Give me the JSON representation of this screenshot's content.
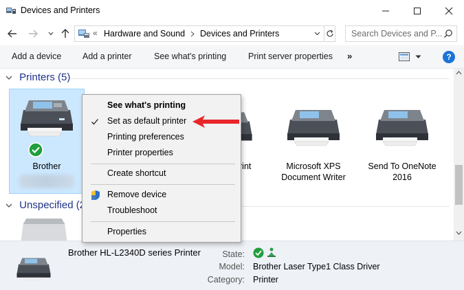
{
  "window": {
    "title": "Devices and Printers"
  },
  "address": {
    "overflow": "«",
    "crumb1": "Hardware and Sound",
    "crumb2": "Devices and Printers",
    "search_placeholder": "Search Devices and P..."
  },
  "toolbar": {
    "add_device": "Add a device",
    "add_printer": "Add a printer",
    "see_printing": "See what's printing",
    "print_server": "Print server properties",
    "more": "»",
    "help": "?"
  },
  "groups": {
    "printers": "Printers (5)",
    "unspecified": "Unspecified (2"
  },
  "devices": [
    {
      "label": "Brother"
    },
    {
      "label": "rint"
    },
    {
      "label": "Microsoft XPS Document Writer"
    },
    {
      "label": "Send To OneNote 2016"
    }
  ],
  "context_menu": {
    "items": [
      {
        "label": "See what's printing"
      },
      {
        "label": "Set as default printer"
      },
      {
        "label": "Printing preferences"
      },
      {
        "label": "Printer properties"
      },
      {
        "label": "Create shortcut"
      },
      {
        "label": "Remove device"
      },
      {
        "label": "Troubleshoot"
      },
      {
        "label": "Properties"
      }
    ]
  },
  "details": {
    "device_name": "Brother HL-L2340D series Printer",
    "state_label": "State:",
    "model_label": "Model:",
    "model_value": "Brother Laser Type1 Class Driver",
    "category_label": "Category:",
    "category_value": "Printer"
  },
  "colors": {
    "accent": "#1a73d9",
    "selection": "#cce8ff",
    "status_ok": "#1f9e3a",
    "arrow": "#e8262b",
    "group_header": "#1e3287"
  }
}
